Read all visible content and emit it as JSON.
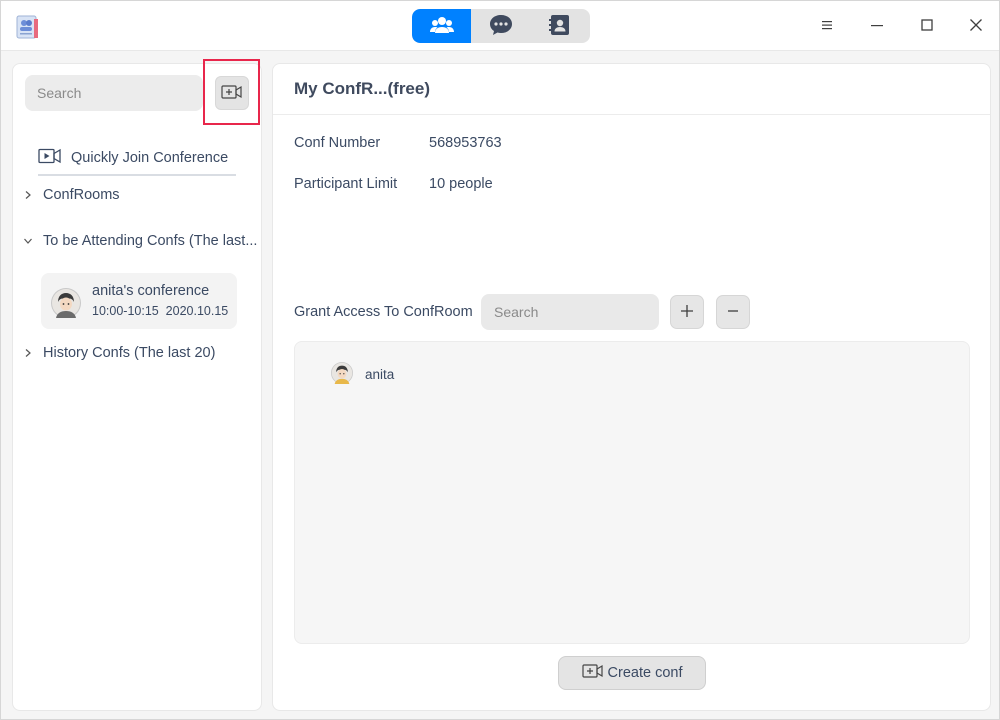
{
  "titlebar": {
    "tabs": [
      {
        "icon": "conference-icon",
        "active": true
      },
      {
        "icon": "chat-icon",
        "active": false
      },
      {
        "icon": "contacts-icon",
        "active": false
      }
    ],
    "accent_color": "#0081ff"
  },
  "sidebar": {
    "search_placeholder": "Search",
    "quick_join_label": "Quickly Join Conference",
    "groups": {
      "confrooms": "ConfRooms",
      "attending": "To be Attending Confs (The last...",
      "history": "History Confs (The last 20)"
    },
    "attending_conf": {
      "name": "anita's conference",
      "time": "10:00-10:15  2020.10.15"
    }
  },
  "main": {
    "title": "My ConfR...(free)",
    "conf_number_label": "Conf Number",
    "conf_number_value": "568953763",
    "participant_limit_label": "Participant Limit",
    "participant_limit_value": "10 people",
    "grant_access_label": "Grant Access To ConfRoom",
    "grant_search_placeholder": "Search",
    "members": [
      {
        "name": "anita"
      }
    ],
    "create_conf_label": "Create conf"
  }
}
